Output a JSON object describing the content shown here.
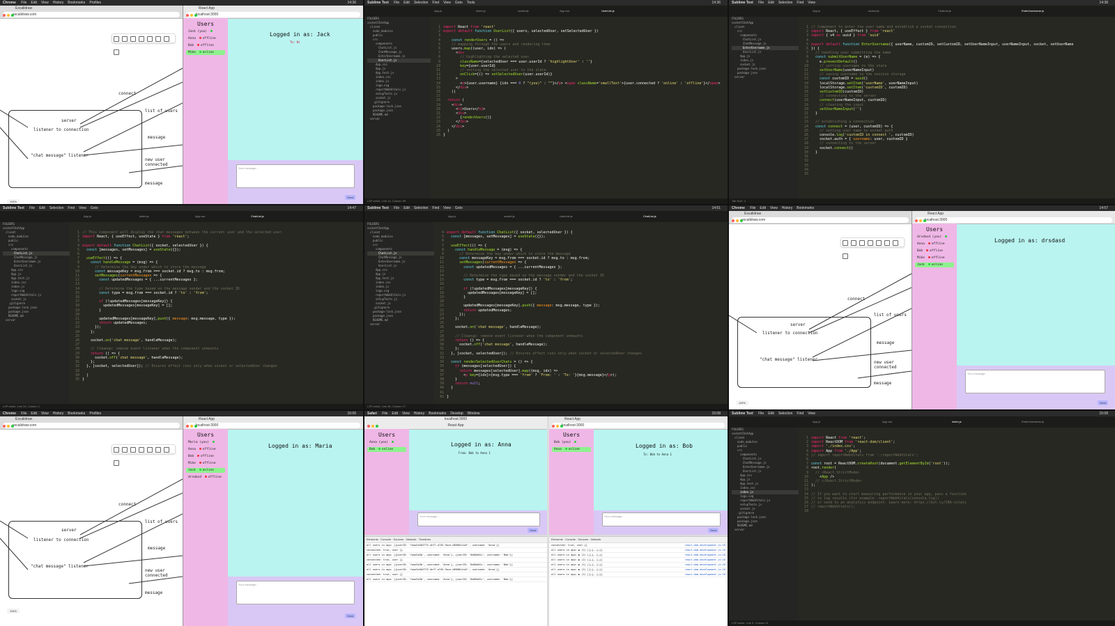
{
  "menubar": {
    "chrome": {
      "app": "Chrome",
      "items": [
        "File",
        "Edit",
        "View",
        "History",
        "Bookmarks",
        "Profiles",
        "Tab",
        "Window",
        "Help"
      ]
    },
    "sublime": {
      "app": "Sublime Text",
      "items": [
        "File",
        "Edit",
        "Selection",
        "Find",
        "View",
        "Goto",
        "Tools",
        "Project",
        "Window",
        "Help"
      ]
    },
    "safari": {
      "app": "Safari",
      "items": [
        "File",
        "Edit",
        "View",
        "History",
        "Bookmarks",
        "Develop",
        "Window",
        "Help"
      ]
    },
    "clocks": [
      "14:36",
      "14:36",
      "14:38",
      "14:47",
      "14:51",
      "14:57",
      "15:06",
      "15:08",
      "15:08"
    ]
  },
  "browser": {
    "excalidraw_tab": "Excalidraw",
    "excalidraw_url": "excalidraw.com",
    "react_tab": "React App",
    "react_url": "localhost:3000",
    "zoom": "115%"
  },
  "sketch": {
    "connect": "connect",
    "list_of_users": "list of users",
    "server": "server",
    "listener": "listener to connection",
    "chat_message": "\"chat message\" listener",
    "message": "message",
    "new_user": "new user connected",
    "message2": "message"
  },
  "react": {
    "users_title": "Users",
    "message_placeholder": "Your message...",
    "send": "Send",
    "panel1": {
      "logged": "Logged in as: Jack",
      "sub": "To: Hi",
      "users": [
        {
          "name": "Jack (you)",
          "status": "online"
        },
        {
          "name": "Anna",
          "status": "offline"
        },
        {
          "name": "Bob",
          "status": "offline"
        },
        {
          "name": "Mike",
          "status": "online"
        }
      ]
    },
    "panel2": {
      "logged": "Logged in as: drsdasd",
      "users": [
        {
          "name": "drsdasd (you)",
          "status": "online"
        },
        {
          "name": "Anna",
          "status": "offline"
        },
        {
          "name": "Bob",
          "status": "offline"
        },
        {
          "name": "Mike",
          "status": "offline"
        },
        {
          "name": "Jack",
          "status": "online"
        }
      ]
    },
    "panel3": {
      "logged": "Logged in as: Maria",
      "users": [
        {
          "name": "Maria (you)",
          "status": "online"
        },
        {
          "name": "Anna",
          "status": "offline"
        },
        {
          "name": "Bob",
          "status": "offline"
        },
        {
          "name": "Mike",
          "status": "offline"
        },
        {
          "name": "Jack",
          "status": "online"
        },
        {
          "name": "drsdasd",
          "status": "offline"
        }
      ]
    },
    "panel4": {
      "logged": "Logged in as: Anna",
      "sub": "From: Bob to Anna 1",
      "users": [
        {
          "name": "Anna (you)",
          "status": "online"
        },
        {
          "name": "Bob",
          "status": "online"
        }
      ]
    },
    "panel5": {
      "logged": "Logged in as: Bob",
      "sub": "To: Bob to Anna 1",
      "users": [
        {
          "name": "Bob (you)",
          "status": "online"
        },
        {
          "name": "Anna",
          "status": "online"
        }
      ]
    }
  },
  "sublime": {
    "folders_label": "FOLDERS",
    "tree": [
      "socketChatApp",
      "client",
      "node_modules",
      "public",
      "src",
      "components",
      "ChatList.js",
      "ChatMessage.js",
      "EnterUsername.js",
      "UserList.js",
      "App.css",
      "App.js",
      "App.test.js",
      "index.css",
      "index.js",
      "logo.svg",
      "reportWebVitals.js",
      "setupTests.js",
      "socket.js",
      ".gitignore",
      "package-lock.json",
      "package.json",
      "README.md",
      "server"
    ],
    "tabs": [
      "App.js",
      "index.js",
      "socket.js",
      "App.css",
      "UserList.js",
      "ChatList.js",
      "EnterUsername.js"
    ],
    "status1": "LSP-eslint, Line 14, Column 99",
    "status2": "LSP-eslint, Line 34, Column 1",
    "status3": "LSP-eslint, Line 48, Column 17",
    "status4": "LSP-eslint, Line 5, Column 11",
    "tabsize": "Tab Size: 4",
    "syntax": "JavaScript (JSX)"
  },
  "devtools": {
    "tabs": [
      "Elements",
      "Console",
      "Sources",
      "Network",
      "Timelines"
    ],
    "rows": [
      "all users in app: [{userID: 'faaa3a3b3775-4ef7-a745-9ace-d8968c2a4f', username: 'Anna'}]",
      "all users in app: [{userID: 'faaa3a3b', username: 'Anna'}, {userID: '8b66e62c', username: 'Bob'}]",
      "connected: true, user {}",
      "all users in app: ▶ (2) [{…}, {…}]",
      "all users in app: ▶ (2) [{…}, {…}]"
    ],
    "link": "react-dom.development.js:16"
  }
}
